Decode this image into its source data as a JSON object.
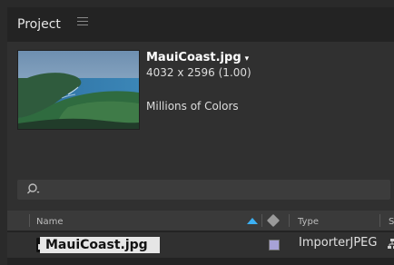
{
  "panel": {
    "title": "Project"
  },
  "preview": {
    "filename": "MauiCoast.jpg",
    "dropdown_symbol": "▾",
    "dimensions": "4032 x 2596 (1.00)",
    "color_depth": "Millions of Colors"
  },
  "search": {
    "icon": "search-icon",
    "value": ""
  },
  "columns": {
    "name": "Name",
    "type": "Type",
    "size": "Si",
    "sort_direction": "ascending",
    "sort_color": "#3cb0f3"
  },
  "rows": [
    {
      "name": "MauiCoast.jpg",
      "type": "ImporterJPEG",
      "label_color": "#a7a2d6"
    }
  ]
}
